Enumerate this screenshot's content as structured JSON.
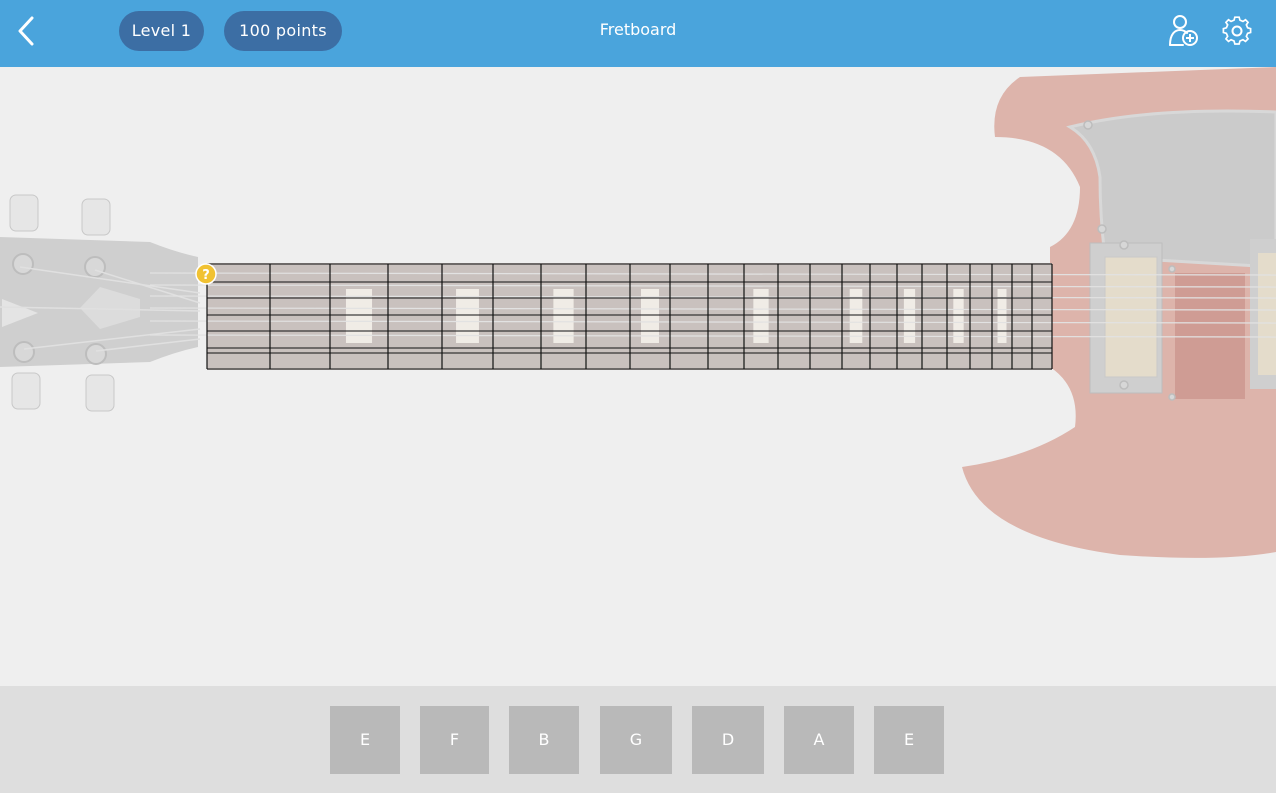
{
  "header": {
    "title": "Fretboard",
    "level": "Level 1",
    "points": "100 points"
  },
  "hint_marker": "?",
  "note_buttons": [
    "E",
    "F",
    "B",
    "G",
    "D",
    "A",
    "E"
  ],
  "colors": {
    "header_bg": "#4aa4dc",
    "pill_bg": "#3c6ea4",
    "background": "#efefef",
    "bottom_bar": "#dedede",
    "note_button": "#b9b9b9",
    "hint_marker": "#f1c232",
    "guitar_body": "#ddb4ab"
  },
  "icons": {
    "back": "chevron-left-icon",
    "add_user": "add-user-icon",
    "settings": "gear-icon"
  }
}
